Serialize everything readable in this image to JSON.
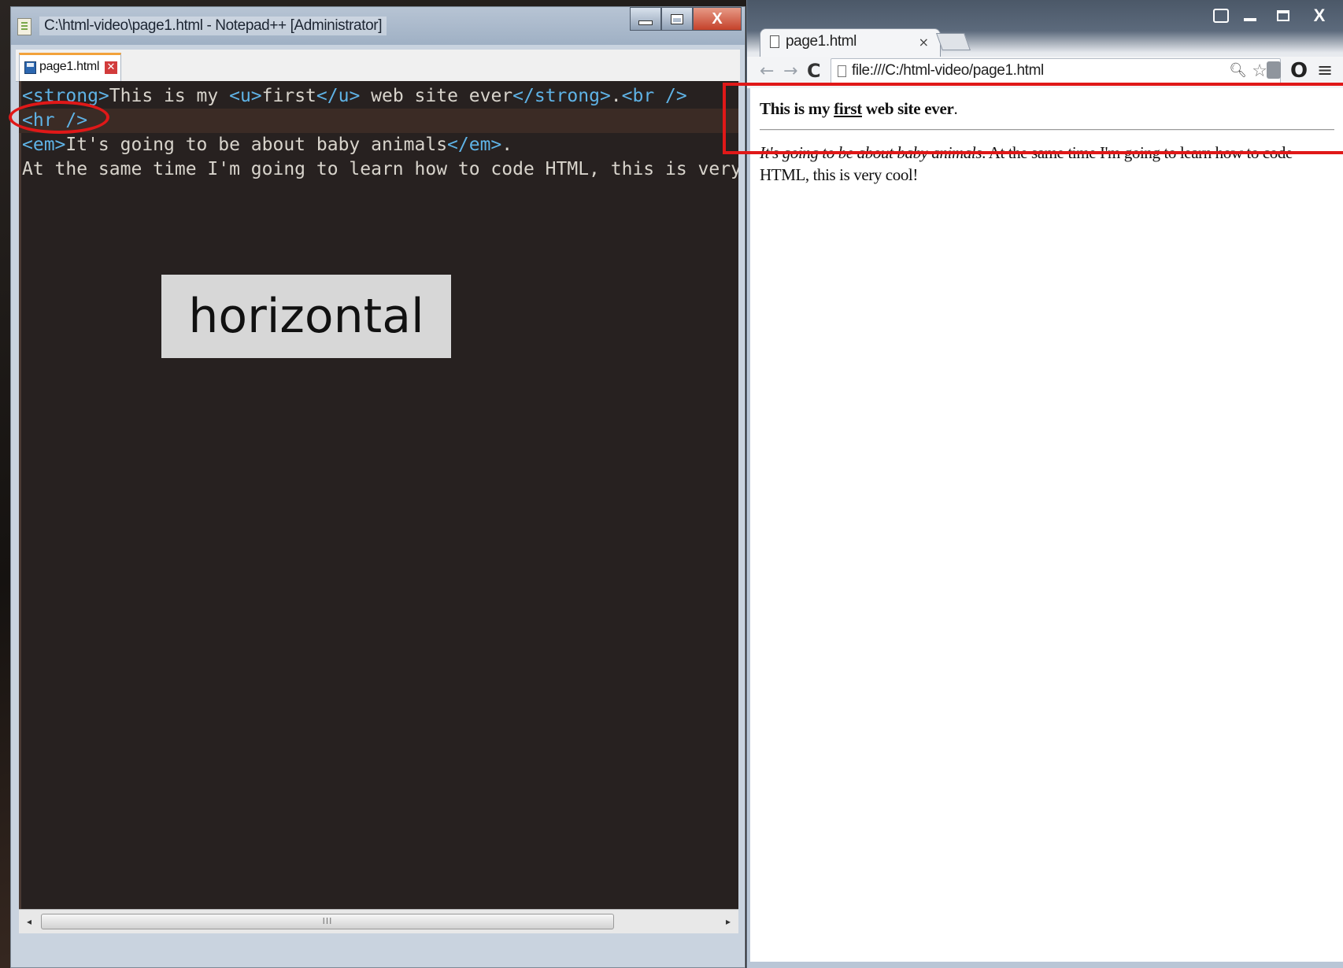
{
  "notepad": {
    "title": "C:\\html-video\\page1.html - Notepad++ [Administrator]",
    "tab_label": "page1.html",
    "code": {
      "line1": {
        "t1": "<strong>",
        "t2": "This is my ",
        "t3": "<u>",
        "t4": "first",
        "t5": "</u>",
        "t6": " web site ever",
        "t7": "</strong>",
        "t8": ".",
        "t9": "<br />"
      },
      "line2": {
        "t1": "<hr />"
      },
      "line3": {
        "t1": "<em>",
        "t2": "It's going to be about baby animals",
        "t3": "</em>",
        "t4": "."
      },
      "line4": {
        "t1": "At the same time I'm going to learn how to code HTML, this is very cool!"
      }
    },
    "caption": "horizontal",
    "close_glyph": "X"
  },
  "browser": {
    "tab_label": "page1.html",
    "tab_close": "×",
    "url": "file:///C:/html-video/page1.html",
    "close_glyph": "X",
    "page": {
      "line1_a": "This is my ",
      "line1_u": "first",
      "line1_b": " web site ever",
      "line1_c": ".",
      "para_em": "It's going to be about baby animals",
      "para_rest": ". At the same time I'm going to learn how to code HTML, this is very cool!"
    }
  },
  "colors": {
    "annotation": "#e01818",
    "editor_bg": "#272120",
    "tag": "#5fb3e6"
  }
}
